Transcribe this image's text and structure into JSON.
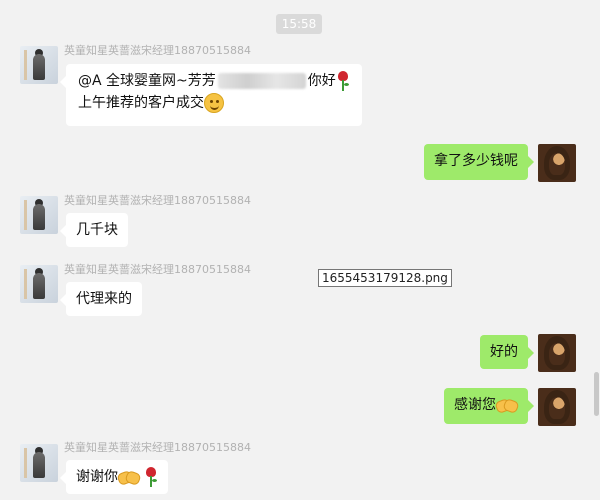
{
  "timestamp": "15:58",
  "sender_name": "英童知星英蔷滋宋经理18870515884",
  "messages": [
    {
      "side": "left",
      "line1_prefix": "@A 全球婴童网~芳芳",
      "line1_suffix": "你好",
      "line2": "上午推荐的客户成交",
      "icons": [
        "blurred-text",
        "rose-icon",
        "smile-emoji-icon"
      ]
    },
    {
      "side": "right",
      "text": "拿了多少钱呢"
    },
    {
      "side": "left",
      "text": "几千块"
    },
    {
      "side": "left",
      "text": "代理来的"
    },
    {
      "side": "right",
      "text": "好的"
    },
    {
      "side": "right",
      "text": "感谢您",
      "icons": [
        "handshake-icon"
      ]
    },
    {
      "side": "left",
      "text": "谢谢你",
      "icons": [
        "handshake-icon",
        "rose-icon"
      ]
    }
  ],
  "tooltip_filename": "1655453179128.png",
  "colors": {
    "background": "#f2f2f2",
    "sent_bubble": "#9eea6a",
    "received_bubble": "#ffffff",
    "sender_name": "#b2b2b2"
  }
}
